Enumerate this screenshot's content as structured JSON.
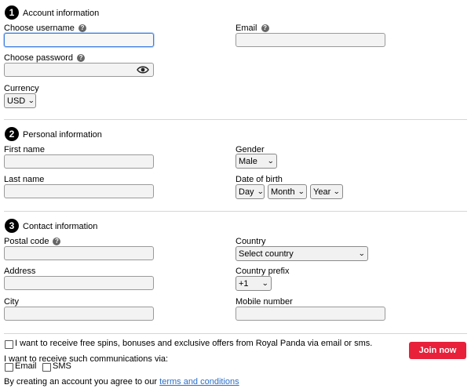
{
  "sections": {
    "account": {
      "number": "1",
      "title": "Account information"
    },
    "personal": {
      "number": "2",
      "title": "Personal information"
    },
    "contact": {
      "number": "3",
      "title": "Contact information"
    }
  },
  "help_glyph": "?",
  "fields": {
    "username": {
      "label": "Choose username",
      "value": ""
    },
    "email": {
      "label": "Email",
      "value": ""
    },
    "password": {
      "label": "Choose password",
      "value": ""
    },
    "currency": {
      "label": "Currency",
      "value": "USD"
    },
    "first_name": {
      "label": "First name",
      "value": ""
    },
    "gender": {
      "label": "Gender",
      "value": "Male"
    },
    "last_name": {
      "label": "Last name",
      "value": ""
    },
    "dob": {
      "label": "Date of birth",
      "day": "Day",
      "month": "Month",
      "year": "Year"
    },
    "postal_code": {
      "label": "Postal code",
      "value": ""
    },
    "country": {
      "label": "Country",
      "value": "Select country"
    },
    "address": {
      "label": "Address",
      "value": ""
    },
    "country_prefix": {
      "label": "Country prefix",
      "value": "+1"
    },
    "city": {
      "label": "City",
      "value": ""
    },
    "mobile": {
      "label": "Mobile number",
      "value": ""
    }
  },
  "consent": {
    "offers_label": "I want to receive free spins, bonuses and exclusive offers from Royal Panda via email or sms.",
    "channels_label": "I want to receive such communications via:",
    "email_label": "Email",
    "sms_label": "SMS",
    "terms_prefix": "By creating an account you agree to our",
    "terms_link": "terms and conditions"
  },
  "join_button": "Join now",
  "icons": {
    "eye": "eye-icon",
    "help": "help-icon",
    "chevron": "chevron-down-icon"
  },
  "colors": {
    "cta": "#e8203a",
    "link": "#2a6fc9",
    "focus": "#3b7de0"
  }
}
